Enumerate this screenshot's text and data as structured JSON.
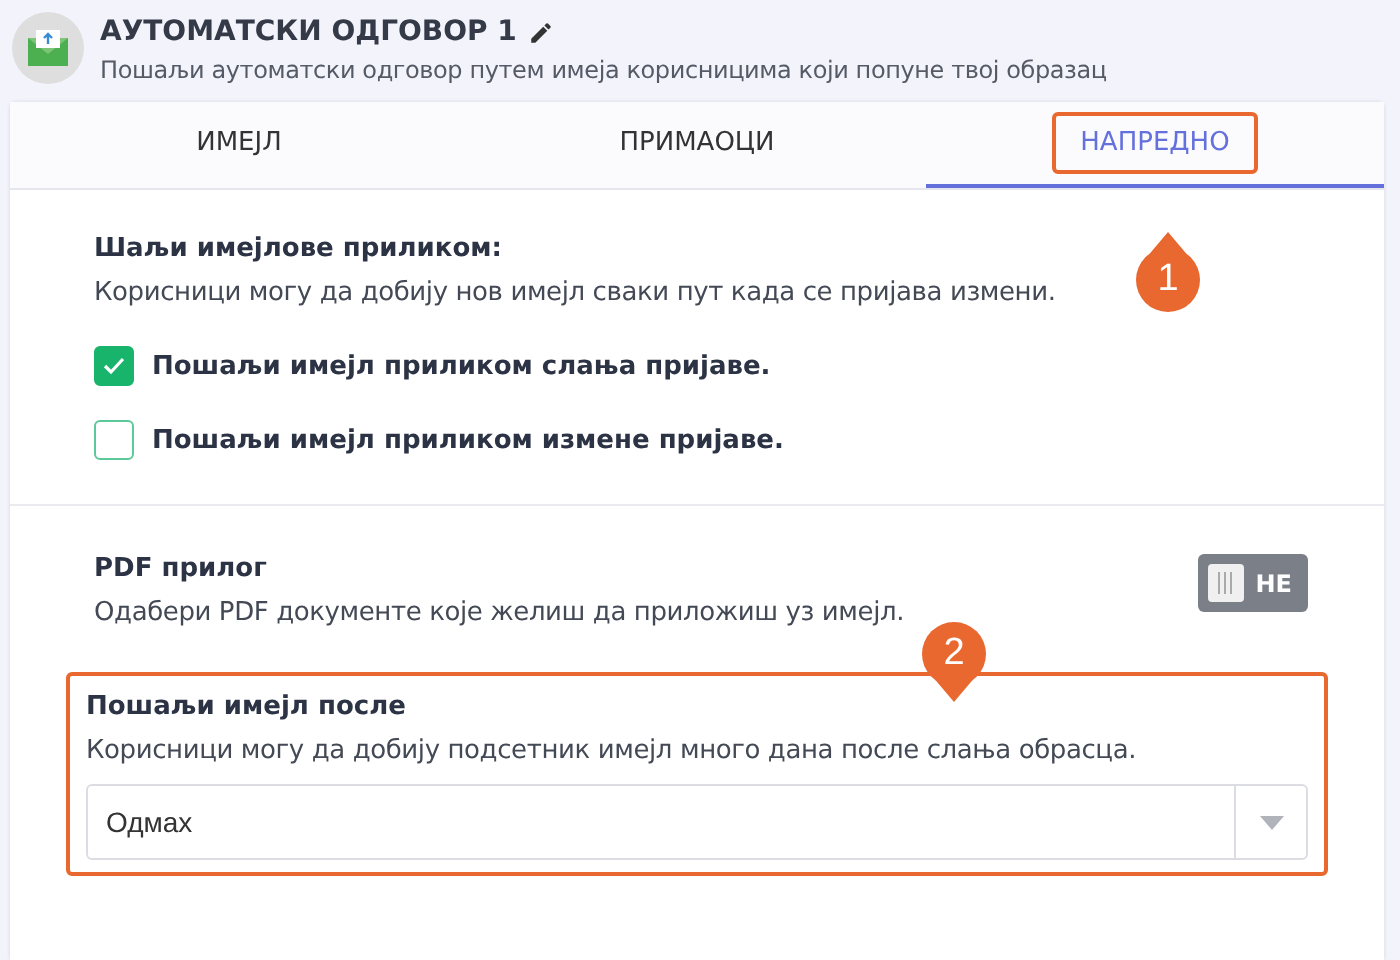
{
  "header": {
    "title": "АУТОМАТСКИ ОДГОВОР 1",
    "subtitle": "Пошаљи аутоматски одговор путем имеја корисницима који попуне твој образац"
  },
  "tabs": [
    {
      "label": "ИМЕЈЛ",
      "selected": false,
      "highlighted": false
    },
    {
      "label": "ПРИМАОЦИ",
      "selected": false,
      "highlighted": false
    },
    {
      "label": "НАПРЕДНО",
      "selected": true,
      "highlighted": true
    }
  ],
  "send_section": {
    "heading": "Шаљи имејлове приликом:",
    "description": "Корисници могу да добију нов имејл сваки пут када се пријава измени.",
    "options": [
      {
        "label": "Пошаљи имејл приликом слања пријаве.",
        "checked": true
      },
      {
        "label": "Пошаљи имејл приликом измене пријаве.",
        "checked": false
      }
    ]
  },
  "pdf_section": {
    "heading": "PDF прилог",
    "description": "Одабери PDF документе које желиш да приложиш уз имејл.",
    "toggle": {
      "label": "НЕ",
      "on": false
    }
  },
  "delay_section": {
    "heading": "Пошаљи имејл после",
    "description": "Корисници могу да добију подсетник имејл много дана после слања обрасца.",
    "highlighted": true,
    "select": {
      "value": "Одмах"
    }
  },
  "markers": [
    {
      "label": "1",
      "kind": "up"
    },
    {
      "label": "2",
      "kind": "down"
    }
  ]
}
